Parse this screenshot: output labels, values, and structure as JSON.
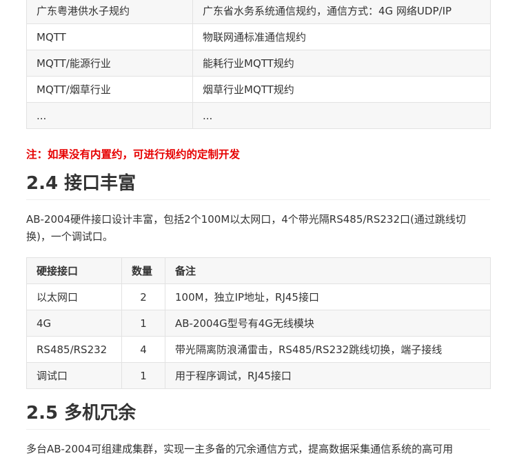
{
  "protocols_table": {
    "rows": [
      [
        "广东粤港供水子规约",
        "广东省水务系统通信规约，通信方式：4G 网络UDP/IP"
      ],
      [
        "MQTT",
        "物联网通标准通信规约"
      ],
      [
        "MQTT/能源行业",
        "能耗行业MQTT规约"
      ],
      [
        "MQTT/烟草行业",
        "烟草行业MQTT规约"
      ],
      [
        "...",
        "..."
      ]
    ]
  },
  "note": "注：如果没有内置约，可进行规约的定制开发",
  "section_2_4": {
    "heading": "2.4 接口丰富",
    "paragraph": "AB-2004硬件接口设计丰富，包括2个100M以太网口，4个带光隔RS485/RS232口(通过跳线切换)，一个调试口。"
  },
  "interface_table": {
    "headers": [
      "硬接接口",
      "数量",
      "备注"
    ],
    "rows": [
      [
        "以太网口",
        "2",
        "100M，独立IP地址，RJ45接口"
      ],
      [
        "4G",
        "1",
        "AB-2004G型号有4G无线模块"
      ],
      [
        "RS485/RS232",
        "4",
        "带光隔离防浪涌雷击，RS485/RS232跳线切换，端子接线"
      ],
      [
        "调试口",
        "1",
        "用于程序调试，RJ45接口"
      ]
    ]
  },
  "section_2_5": {
    "heading": "2.5 多机冗余",
    "paragraph": "多台AB-2004可组建成集群，实现一主多备的冗余通信方式，提高数据采集通信系统的高可用"
  }
}
